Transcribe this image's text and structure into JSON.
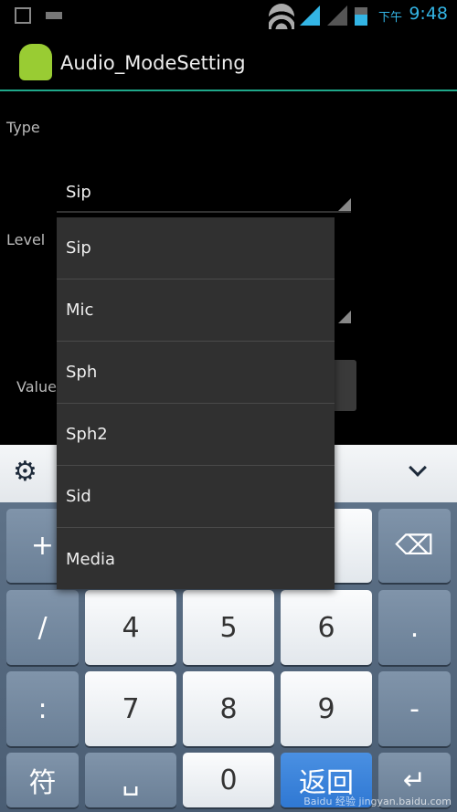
{
  "status_bar": {
    "ampm": "下午",
    "time": "9:48",
    "icons": [
      "gallery-icon",
      "keyboard-icon",
      "wifi-icon",
      "signal-icon",
      "no-signal-icon",
      "battery-icon"
    ]
  },
  "app": {
    "title": "Audio_ModeSetting",
    "accent": "#1fa88a"
  },
  "form": {
    "type_label": "Type",
    "type_value": "Sip",
    "level_label": "Level",
    "value_label": "Value"
  },
  "dropdown": {
    "options": [
      "Sip",
      "Mic",
      "Sph",
      "Sph2",
      "Sid",
      "Media"
    ]
  },
  "keyboard": {
    "rows": [
      [
        "+",
        "",
        "",
        "",
        ""
      ],
      [
        "/",
        "4",
        "5",
        "6",
        "."
      ],
      [
        ":",
        "7",
        "8",
        "9",
        "-"
      ],
      [
        "符",
        "␣",
        "0",
        "返回",
        "↵"
      ]
    ]
  },
  "watermark": "Baidu 经验 jingyan.baidu.com"
}
